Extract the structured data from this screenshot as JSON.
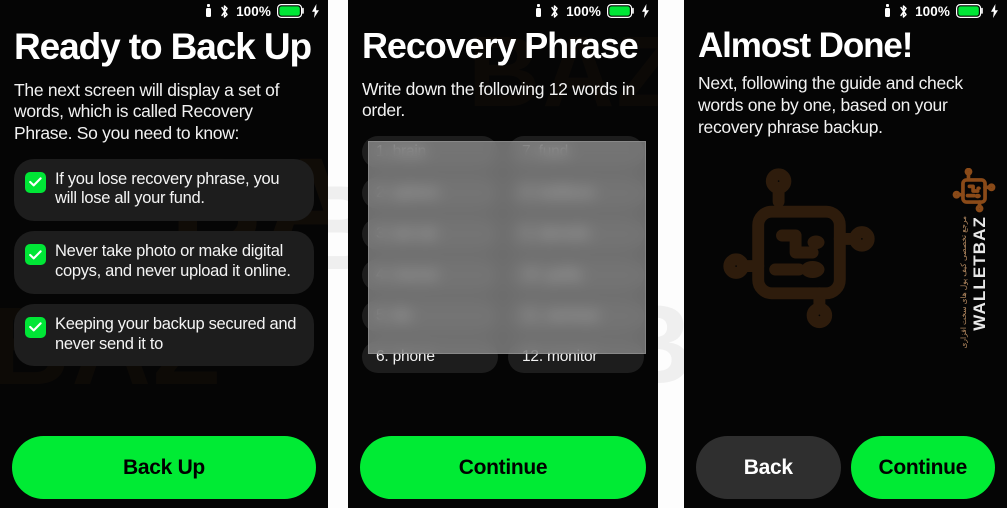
{
  "colors": {
    "accent_green": "#00eb34",
    "panel_bg": "#050505",
    "card_bg": "#1d1d1d",
    "secondary_button": "#2f2f2f",
    "watermark_brown": "#7a4a1e",
    "gutter_white": "#fdfdfd"
  },
  "status_bar": {
    "battery_percent": "100%",
    "icons": [
      "usb-device-icon",
      "bluetooth-icon",
      "battery-icon",
      "charging-bolt-icon"
    ]
  },
  "screens": [
    {
      "id": "ready-to-back-up",
      "title": "Ready to Back Up",
      "lede": "The next screen will display a set of words, which is called Recovery Phrase. So you need to know:",
      "checklist": [
        "If you lose recovery phrase, you will lose all your fund.",
        "Never take photo or make digital copys, and never upload it online.",
        "Keeping your backup secured and never send it to"
      ],
      "buttons": [
        {
          "label": "Back Up",
          "style": "primary"
        }
      ]
    },
    {
      "id": "recovery-phrase",
      "title": "Recovery Phrase",
      "lede": "Write down the following 12 words in order.",
      "word_count": 12,
      "words": [
        {
          "index": "1.",
          "word": "brain",
          "blurred": true
        },
        {
          "index": "7.",
          "word": "fund",
          "blurred": true
        },
        {
          "index": "2.",
          "word": "sphere",
          "blurred": true
        },
        {
          "index": "8.",
          "word": "bulldoze",
          "blurred": true
        },
        {
          "index": "3.",
          "word": "tuk tuk",
          "blurred": true
        },
        {
          "index": "9.",
          "word": "demolic",
          "blurred": true
        },
        {
          "index": "4.",
          "word": "rescue",
          "blurred": true
        },
        {
          "index": "10.",
          "word": "guilty",
          "blurred": true
        },
        {
          "index": "5.",
          "word": "tile",
          "blurred": true
        },
        {
          "index": "11.",
          "word": "seminar",
          "blurred": true
        },
        {
          "index": "6.",
          "word": "phone",
          "blurred": false
        },
        {
          "index": "12.",
          "word": "monitor",
          "blurred": false
        }
      ],
      "buttons": [
        {
          "label": "Continue",
          "style": "primary"
        }
      ]
    },
    {
      "id": "almost-done",
      "title": "Almost Done!",
      "lede": "Next, following the guide and check words one by one, based on your recovery phrase backup.",
      "buttons": [
        {
          "label": "Back",
          "style": "secondary"
        },
        {
          "label": "Continue",
          "style": "primary"
        }
      ]
    }
  ],
  "watermark": {
    "brand": "WALLETBAZ",
    "subtitle": "مرجع تخصصی کیف پول های سخت افزاری",
    "background_text": "BAZ"
  }
}
